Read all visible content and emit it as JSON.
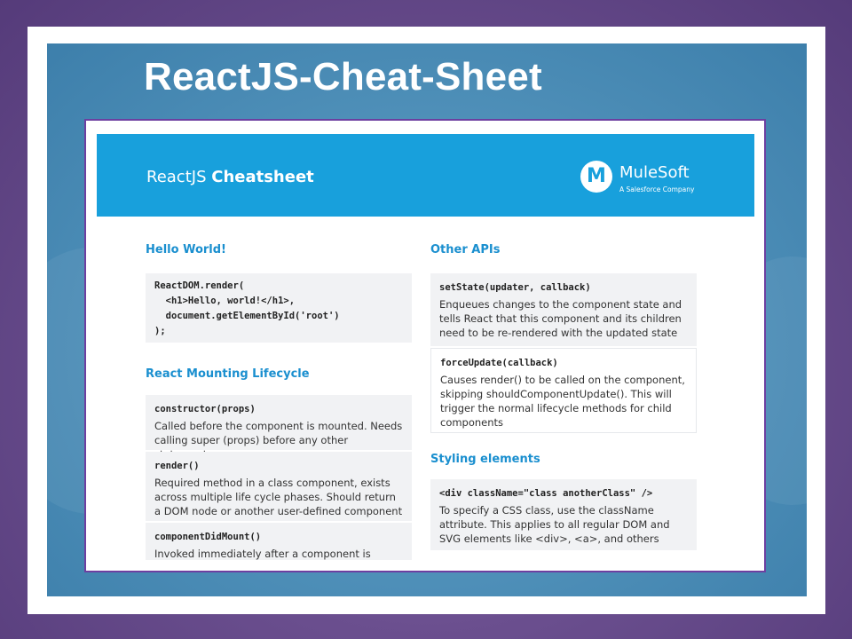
{
  "slide": {
    "title": "ReactJS-Cheat-Sheet"
  },
  "header": {
    "title_light": "ReactJS",
    "title_bold": "Cheatsheet",
    "logo_mark": "M",
    "logo_name": "MuleSoft",
    "logo_tagline": "A Salesforce Company"
  },
  "left": {
    "hello": {
      "title": "Hello World!",
      "code": [
        "ReactDOM.render(",
        "  <h1>Hello, world!</h1>,",
        "  document.getElementById('root')",
        ");"
      ]
    },
    "lifecycle": {
      "title": "React Mounting Lifecycle",
      "items": [
        {
          "code": "constructor(props)",
          "desc": "Called before the component is mounted. Needs calling super (props) before any other statement"
        },
        {
          "code": "render()",
          "desc": "Required method in a class component, exists across multiple life cycle phases. Should return a DOM node or another user-defined component"
        },
        {
          "code": "componentDidMount()",
          "desc": "Invoked immediately after a component is mounted"
        }
      ]
    }
  },
  "right": {
    "apis": {
      "title": "Other APIs",
      "items": [
        {
          "code": "setState(updater, callback)",
          "desc": "Enqueues changes to the component state and tells React that this component and its children need to be re-rendered with the updated state"
        },
        {
          "code": "forceUpdate(callback)",
          "desc": "Causes render() to be called on the component, skipping shouldComponentUpdate(). This will trigger the normal lifecycle methods for child components"
        }
      ]
    },
    "styling": {
      "title": "Styling elements",
      "items": [
        {
          "code": "<div className=\"class anotherClass\" />",
          "desc": "To specify a CSS class, use the className attribute. This applies to all regular DOM and SVG elements like <div>, <a>, and others"
        }
      ]
    }
  },
  "colors": {
    "header_blue": "#18a0dc",
    "section_title": "#1a8fcf",
    "frame_purple": "#6d3fa0"
  }
}
